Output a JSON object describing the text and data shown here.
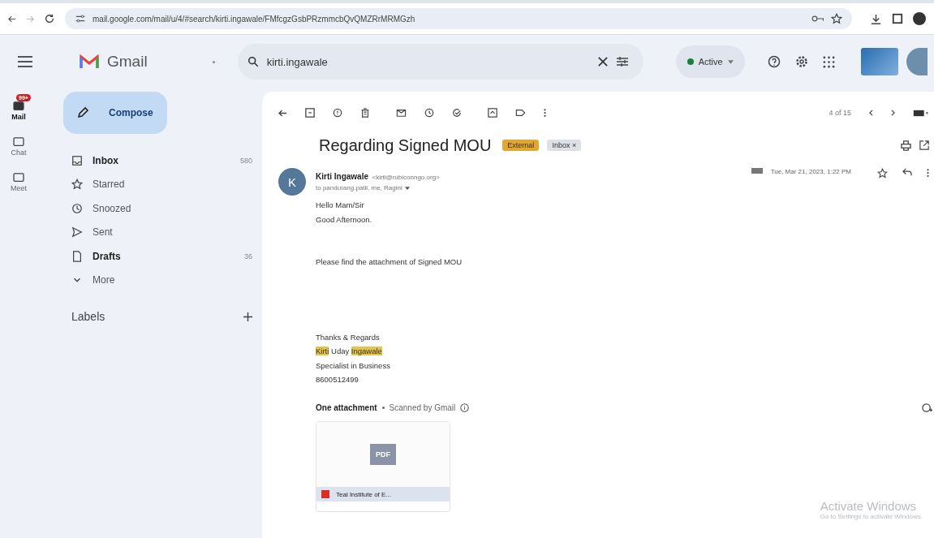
{
  "browser": {
    "url": "mail.google.com/mail/u/4/#search/kirti.ingawale/FMfcgzGsbPRzmmcbQvQMZRrMRMGzh"
  },
  "header": {
    "app_name": "Gmail",
    "search_value": "kirti.ingawale",
    "status": "Active"
  },
  "rail": [
    {
      "label": "Mail",
      "badge": "99+",
      "selected": true
    },
    {
      "label": "Chat",
      "selected": false
    },
    {
      "label": "Meet",
      "selected": false
    }
  ],
  "compose": "Compose",
  "nav": [
    {
      "label": "Inbox",
      "count": "580",
      "bold": true,
      "kind": "inbox"
    },
    {
      "label": "Starred",
      "bold": false,
      "kind": "star"
    },
    {
      "label": "Snoozed",
      "bold": false,
      "kind": "clock"
    },
    {
      "label": "Sent",
      "bold": false,
      "kind": "send"
    },
    {
      "label": "Drafts",
      "count": "36",
      "bold": true,
      "kind": "draft"
    },
    {
      "label": "More",
      "bold": false,
      "kind": "more"
    }
  ],
  "labels_heading": "Labels",
  "pager": "4 of 15",
  "subject": "Regarding Signed MOU",
  "tags": [
    {
      "label": "External",
      "color": "#e3a72f"
    },
    {
      "label": "Inbox ×",
      "color": "#dde1e6"
    }
  ],
  "message": {
    "avatar": "K",
    "sender": "Kirti Ingawale",
    "email": "<kirti@rubiconngo.org>",
    "recipients": "to pandurang.patil, me, Ragini",
    "date": "Tue, Mar 21, 2023, 1:22 PM",
    "paragraphs": [
      [
        [
          {
            "text": "Hello Mam/Sir",
            "highlighted": false
          }
        ],
        [
          {
            "text": "Good Afternoon.",
            "highlighted": false
          }
        ]
      ],
      [
        [
          {
            "text": "Please find the attachment of Signed MOU",
            "highlighted": false
          }
        ]
      ],
      [
        [
          {
            "text": "Thanks & Regards",
            "highlighted": false
          }
        ],
        [
          {
            "text": "Kirti",
            "highlighted": true
          },
          {
            "text": " Uday ",
            "highlighted": false
          },
          {
            "text": "Ingawale",
            "highlighted": true
          }
        ],
        [
          {
            "text": "Specialist in Business",
            "highlighted": false
          }
        ],
        [
          {
            "text": "8600512499",
            "highlighted": false
          }
        ]
      ]
    ]
  },
  "attachments": {
    "heading": "One attachment",
    "scanned": "Scanned by Gmail",
    "file_type": "PDF",
    "file_name": "Teal Institute of E..."
  },
  "watermark": {
    "title": "Activate Windows",
    "subtitle": "Go to Settings to activate Windows."
  }
}
